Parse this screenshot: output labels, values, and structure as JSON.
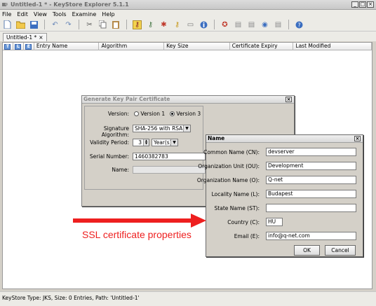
{
  "window": {
    "title": "Untitled-1 * - KeyStore Explorer 5.1.1"
  },
  "menu": [
    "File",
    "Edit",
    "View",
    "Tools",
    "Examine",
    "Help"
  ],
  "toolbar_icons": [
    "new-icon",
    "open-icon",
    "save-icon",
    "undo-icon",
    "redo-icon",
    "cut-icon",
    "copy-icon",
    "paste-icon",
    "generate-key-pair-icon",
    "generate-secret-key-icon",
    "import-trusted-certificate-icon",
    "import-key-pair-icon",
    "set-password-icon",
    "properties-icon",
    "examine-file-icon",
    "examine-clipboard-icon",
    "examine-ssl-icon",
    "examine-csr-icon",
    "examine-crl-icon",
    "help-icon"
  ],
  "doc_tab": {
    "label": "Untitled-1 *",
    "close": "×"
  },
  "table": {
    "type_icons": [
      "T",
      "L",
      "E"
    ],
    "columns": [
      "Entry Name",
      "Algorithm",
      "Key Size",
      "Certificate Expiry",
      "Last Modified"
    ]
  },
  "status": "KeyStore Type: JKS, Size: 0 Entries, Path: 'Untitled-1'",
  "generate_dialog": {
    "title": "Generate Key Pair Certificate",
    "version_label": "Version:",
    "version_options": [
      "Version 1",
      "Version 3"
    ],
    "version_selected": "Version 3",
    "sig_alg_label": "Signature Algorithm:",
    "sig_alg_value": "SHA-256 with RSA",
    "validity_label": "Validity Period:",
    "validity_value": "3",
    "validity_unit": "Year(s)",
    "serial_label": "Serial Number:",
    "serial_value": "1460382783",
    "name_label": "Name:"
  },
  "name_dialog": {
    "title": "Name",
    "fields": [
      {
        "label": "Common Name (CN):",
        "value": "devserver"
      },
      {
        "label": "Organization Unit (OU):",
        "value": "Development"
      },
      {
        "label": "Organization Name (O):",
        "value": "Q-net"
      },
      {
        "label": "Locality Name (L):",
        "value": "Budapest"
      },
      {
        "label": "State Name (ST):",
        "value": ""
      },
      {
        "label": "Country (C):",
        "value": "HU"
      },
      {
        "label": "Email (E):",
        "value": "info@q-net.com"
      }
    ],
    "ok_label": "OK",
    "cancel_label": "Cancel"
  },
  "annotation": {
    "text": "SSL certificate properties",
    "color": "#ee1f1f"
  },
  "colors": {
    "accent_blue": "#305fae",
    "annotation_red": "#ee1f1f"
  }
}
